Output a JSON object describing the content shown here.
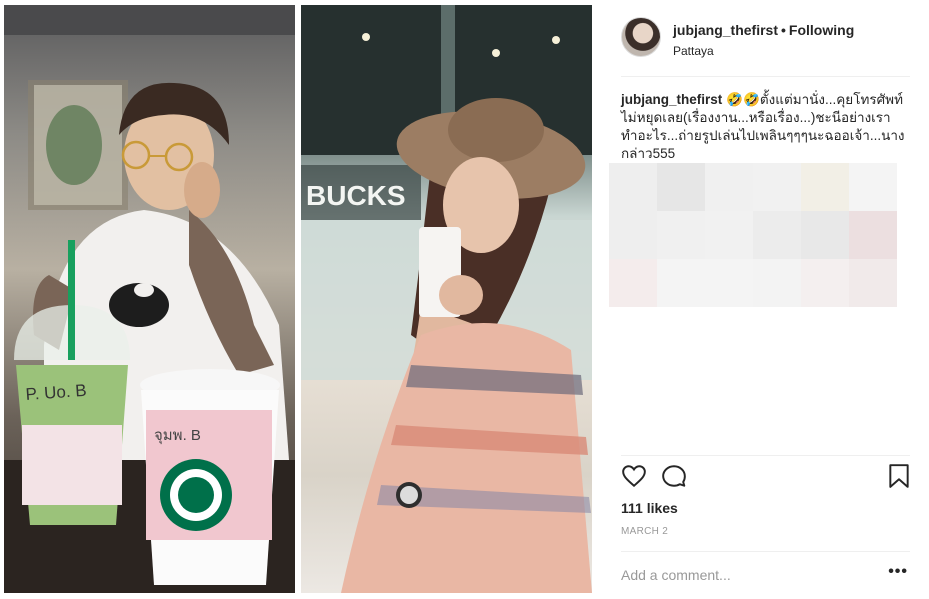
{
  "post": {
    "username": "jubjang_thefirst",
    "separator": "•",
    "follow_status": "Following",
    "location": "Pattaya",
    "caption_user": "jubjang_thefirst",
    "caption_text": "🤣🤣ตั้งแต่มานั่ง...คุยโทรศัพท์ไม่หยุดเลย(เรื่องงาน...หรือเรื่อง...)ชะนีอย่างเราทำอะไร...ถ่ายรูปเล่นไปเพลินๆๆๆนะฉออเจ้า...นางกล่าว555",
    "likes": "111 likes",
    "date": "MARCH 2",
    "comment_placeholder": "Add a comment...",
    "more_label": "•••"
  },
  "icons": {
    "like": "heart-outline-icon",
    "comment": "comment-bubble-icon",
    "save": "bookmark-outline-icon",
    "more": "more-options-icon"
  },
  "photos": {
    "left_cup_label_1": "P. Uo. B",
    "left_cup_label_2": "จุมพ. B",
    "sign_text": "BUCKS"
  },
  "colors": {
    "text": "#262626",
    "muted": "#999999",
    "divider": "#efefef",
    "starbucks_green": "#00704a",
    "pixel_tiles": [
      "#eeeeee",
      "#e6e6e6",
      "#f0f0f0",
      "#f1f1f1",
      "#f2efe6",
      "#f4f4f4",
      "#eeeeee",
      "#f0f0f0",
      "#f1f1f1",
      "#ececec",
      "#e8e8e8",
      "#ecdfe0",
      "#f4ecec",
      "#f4f4f4",
      "#f4f4f4",
      "#f3f3f3",
      "#f4efef",
      "#f1eaea"
    ]
  }
}
